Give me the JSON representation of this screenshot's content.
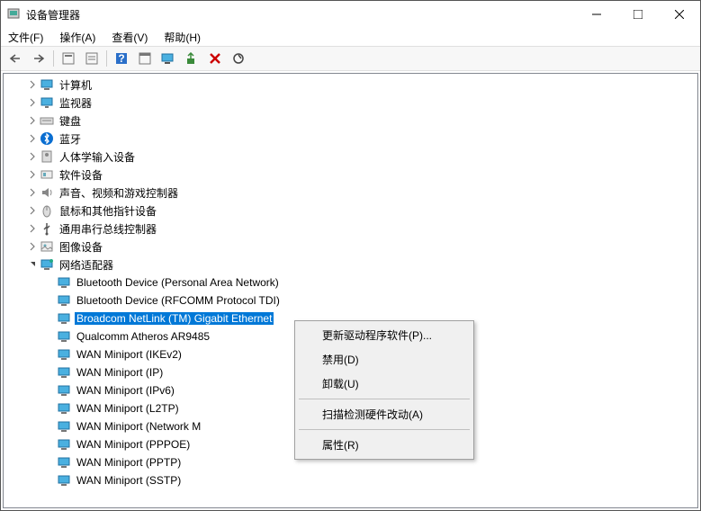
{
  "window": {
    "title": "设备管理器",
    "min": "—",
    "max": "☐",
    "close": "✕"
  },
  "menu": {
    "file": "文件(F)",
    "action": "操作(A)",
    "view": "查看(V)",
    "help": "帮助(H)"
  },
  "categories": [
    {
      "icon": "computer",
      "label": "计算机"
    },
    {
      "icon": "monitor",
      "label": "监视器"
    },
    {
      "icon": "keyboard",
      "label": "键盘"
    },
    {
      "icon": "bluetooth",
      "label": "蓝牙"
    },
    {
      "icon": "hid",
      "label": "人体学输入设备"
    },
    {
      "icon": "software",
      "label": "软件设备"
    },
    {
      "icon": "sound",
      "label": "声音、视频和游戏控制器"
    },
    {
      "icon": "mouse",
      "label": "鼠标和其他指针设备"
    },
    {
      "icon": "usb",
      "label": "通用串行总线控制器"
    },
    {
      "icon": "image",
      "label": "图像设备"
    }
  ],
  "netcat": {
    "label": "网络适配器"
  },
  "adapters": [
    "Bluetooth Device (Personal Area Network)",
    "Bluetooth Device (RFCOMM Protocol TDI)",
    "Broadcom NetLink (TM) Gigabit Ethernet",
    "Qualcomm Atheros AR9485",
    "WAN Miniport (IKEv2)",
    "WAN Miniport (IP)",
    "WAN Miniport (IPv6)",
    "WAN Miniport (L2TP)",
    "WAN Miniport (Network Monitor)",
    "WAN Miniport (PPPOE)",
    "WAN Miniport (PPTP)",
    "WAN Miniport (SSTP)"
  ],
  "selected_index": 2,
  "ctx": {
    "update": "更新驱动程序软件(P)...",
    "disable": "禁用(D)",
    "uninstall": "卸载(U)",
    "scan": "扫描检测硬件改动(A)",
    "props": "属性(R)"
  }
}
